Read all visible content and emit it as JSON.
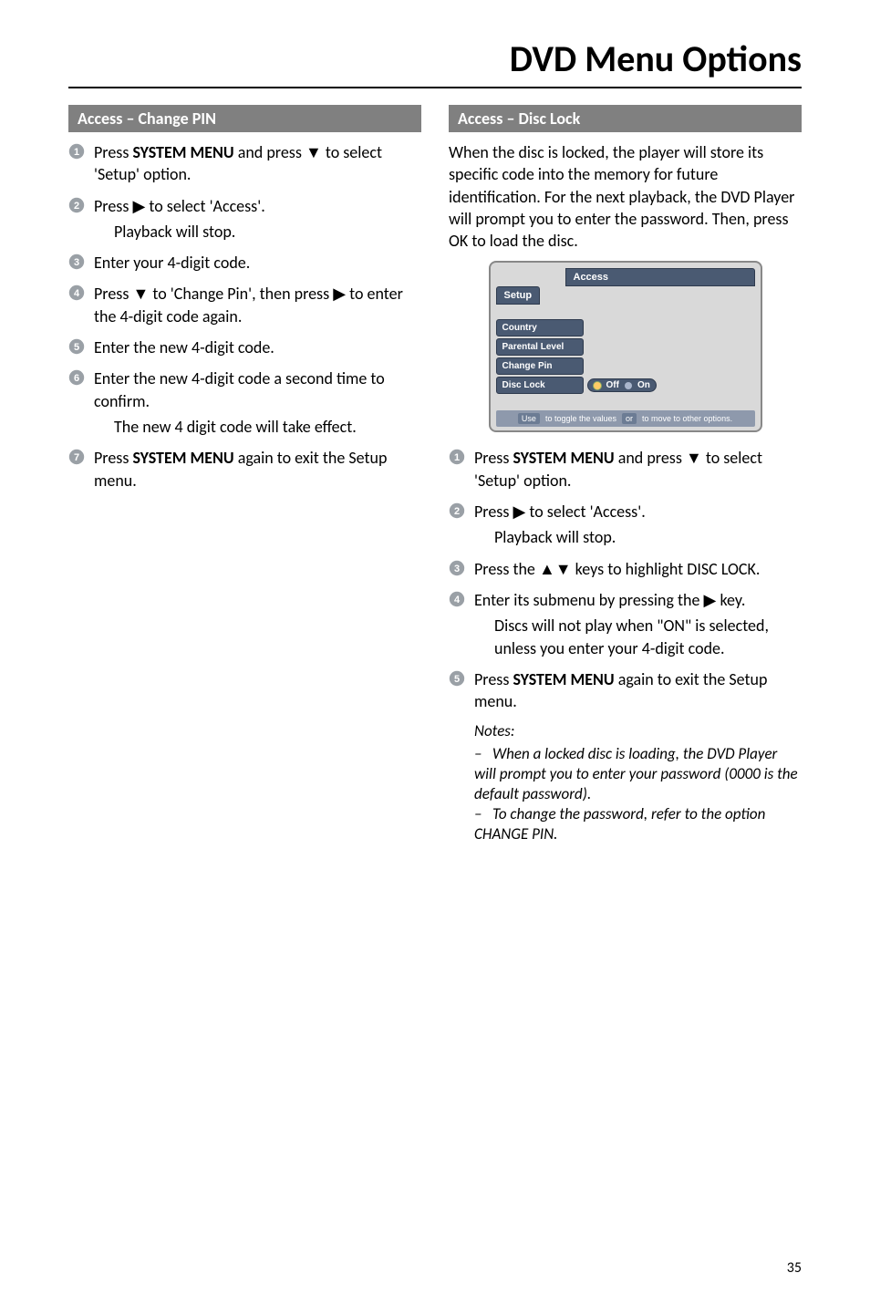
{
  "pageTitle": "DVD Menu Options",
  "pageNumber": "35",
  "left": {
    "header": "Access –  Change PIN",
    "steps": [
      {
        "n": 1,
        "parts": [
          "Press ",
          [
            "b",
            "SYSTEM MENU"
          ],
          " and press ",
          [
            "a",
            "▼"
          ],
          " to select 'Setup' option."
        ]
      },
      {
        "n": 2,
        "parts": [
          "Press ",
          [
            "a",
            "▶"
          ],
          " to select 'Access'."
        ],
        "sub": "Playback will stop."
      },
      {
        "n": 3,
        "parts": [
          "Enter your 4-digit code."
        ]
      },
      {
        "n": 4,
        "parts": [
          "Press ",
          [
            "a",
            "▼"
          ],
          " to 'Change Pin', then press ",
          [
            "a",
            "▶"
          ],
          " to enter the 4-digit code again."
        ]
      },
      {
        "n": 5,
        "parts": [
          "Enter the new 4-digit code."
        ]
      },
      {
        "n": 6,
        "parts": [
          "Enter the new 4-digit code a second time to confirm."
        ],
        "sub": "The new 4 digit code will take effect."
      },
      {
        "n": 7,
        "parts": [
          "Press ",
          [
            "b",
            "SYSTEM MENU"
          ],
          " again to exit the Setup menu."
        ]
      }
    ]
  },
  "right": {
    "header": "Access –  Disc Lock",
    "intro": "When the disc is locked, the player will store its specific code into the memory for future identification. For the next playback, the DVD Player will prompt you to enter the password.  Then, press OK to load the disc.",
    "ui": {
      "topTab": "Setup",
      "topBar": "Access",
      "rows": [
        {
          "label": "Country"
        },
        {
          "label": "Parental Level"
        },
        {
          "label": "Change Pin"
        },
        {
          "label": "Disc Lock",
          "options": [
            "Off",
            "On"
          ],
          "selected": 0
        }
      ],
      "footer": {
        "pre": "Use",
        "mid": "to toggle the values",
        "or": "or",
        "post": "to move to other options."
      }
    },
    "steps": [
      {
        "n": 1,
        "parts": [
          "Press ",
          [
            "b",
            "SYSTEM MENU"
          ],
          " and press ",
          [
            "a",
            "▼"
          ],
          " to select 'Setup' option."
        ]
      },
      {
        "n": 2,
        "parts": [
          "Press ",
          [
            "a",
            "▶"
          ],
          " to select 'Access'."
        ],
        "sub": "Playback will stop."
      },
      {
        "n": 3,
        "parts": [
          "Press the ",
          [
            "a",
            "▲▼"
          ],
          " keys to highlight DISC LOCK."
        ]
      },
      {
        "n": 4,
        "parts": [
          "Enter its submenu by pressing the ",
          [
            "a",
            "▶"
          ],
          " key."
        ],
        "sub": "Discs will not play when \"ON\" is selected, unless you enter your 4-digit code."
      },
      {
        "n": 5,
        "parts": [
          "Press ",
          [
            "b",
            "SYSTEM MENU"
          ],
          " again to exit the Setup menu."
        ]
      }
    ],
    "notes": {
      "head": "Notes:",
      "items": [
        "When a locked disc is loading, the DVD Player will prompt you to enter your password (0000 is the default password).",
        "To change the password, refer to the option CHANGE PIN."
      ]
    }
  }
}
